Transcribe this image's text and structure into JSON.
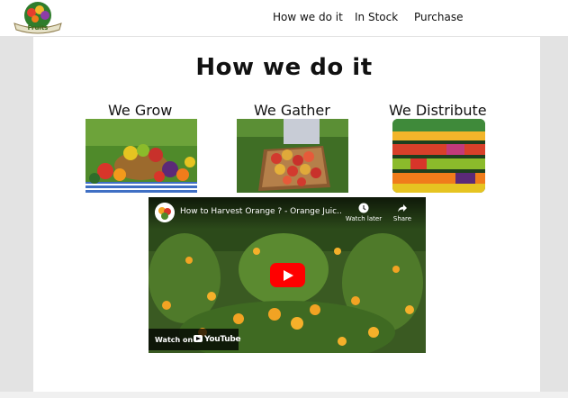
{
  "header": {
    "logo_text": "Fruits",
    "nav": [
      "How we do it",
      "In Stock",
      "Purchase"
    ]
  },
  "page": {
    "title": "How we do it"
  },
  "sections": [
    {
      "label": "We Grow",
      "image_icon": "fruit-basket-image"
    },
    {
      "label": "We Gather",
      "image_icon": "apple-crate-image"
    },
    {
      "label": "We Distribute",
      "image_icon": "produce-shelves-image"
    }
  ],
  "video": {
    "title": "How to Harvest Orange ? - Orange Juic...",
    "watch_later": "Watch later",
    "share": "Share",
    "watch_on": "Watch on",
    "brand": "YouTube"
  },
  "colors": {
    "play_button": "#ff0000",
    "grey_background": "#e3e3e3"
  }
}
